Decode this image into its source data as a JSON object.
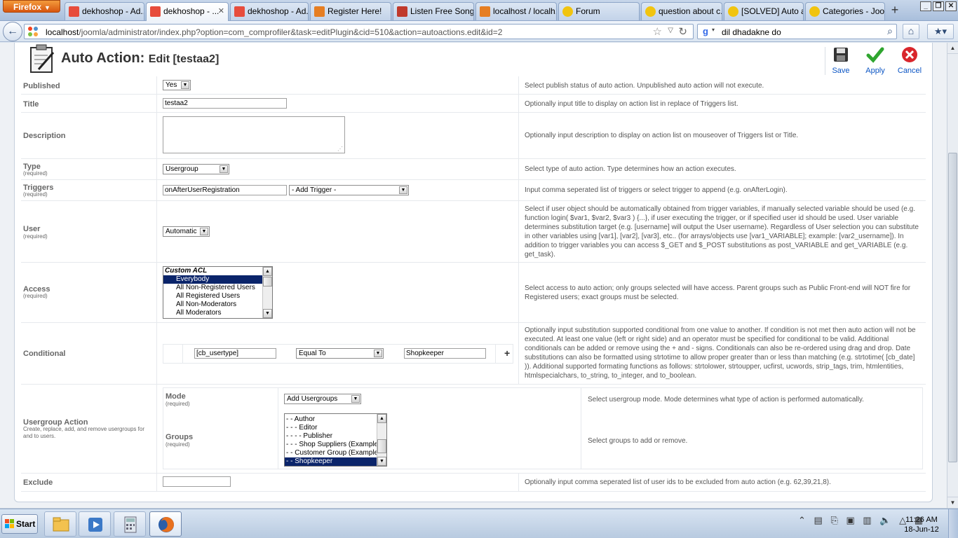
{
  "browser": {
    "menu_label": "Firefox",
    "tabs": [
      {
        "title": "dekhoshop - Ad...",
        "color": "#e74c3c"
      },
      {
        "title": "dekhoshop - ...",
        "color": "#e74c3c"
      },
      {
        "title": "dekhoshop - Ad...",
        "color": "#e74c3c"
      },
      {
        "title": "Register Here!",
        "color": "#e67e22"
      },
      {
        "title": "Listen Free Song...",
        "color": "#c0392b"
      },
      {
        "title": "localhost / localh...",
        "color": "#e67e22"
      },
      {
        "title": "Forum",
        "color": "#f1c40f"
      },
      {
        "title": "question about c...",
        "color": "#f1c40f"
      },
      {
        "title": "[SOLVED] Auto a...",
        "color": "#f1c40f"
      },
      {
        "title": "Categories - Joo...",
        "color": "#f1c40f"
      }
    ],
    "new_tab": "+",
    "url_host": "localhost",
    "url_rest": "/joomla/administrator/index.php?option=com_comprofiler&task=editPlugin&cid=510&action=autoactions.edit&id=2",
    "search_query": "dil dhadakne do"
  },
  "page": {
    "title": "Auto Action:",
    "subtitle": "Edit [testaa2]",
    "toolbar": {
      "save": "Save",
      "apply": "Apply",
      "cancel": "Cancel"
    }
  },
  "form": {
    "required_note": "(required)",
    "published": {
      "label": "Published",
      "value": "Yes",
      "desc": "Select publish status of auto action. Unpublished auto action will not execute."
    },
    "title": {
      "label": "Title",
      "value": "testaa2",
      "desc": "Optionally input title to display on action list in replace of Triggers list."
    },
    "description": {
      "label": "Description",
      "desc": "Optionally input description to display on action list on mouseover of Triggers list or Title."
    },
    "type": {
      "label": "Type",
      "value": "Usergroup",
      "desc": "Select type of auto action. Type determines how an action executes."
    },
    "triggers": {
      "label": "Triggers",
      "value": "onAfterUserRegistration",
      "add": "- Add Trigger -",
      "desc": "Input comma seperated list of triggers or select trigger to append (e.g. onAfterLogin)."
    },
    "user": {
      "label": "User",
      "value": "Automatic",
      "desc": "Select if user object should be automatically obtained from trigger variables, if manually selected variable should be used (e.g. function login( $var1, $var2, $var3 ) {...}, if user executing the trigger, or if specified user id should be used. User variable determines substitution target (e.g. [username] will output the User username). Regardless of User selection you can substitute in other variables using [var1], [var2], [var3], etc.. (for arrays/objects use [var1_VARIABLE]; example: [var2_username]). In addition to trigger variables you can access $_GET and $_POST substitutions as post_VARIABLE and get_VARIABLE (e.g. get_task)."
    },
    "access": {
      "label": "Access",
      "options": [
        "Custom ACL",
        "Everybody",
        "All Non-Registered Users",
        "All Registered Users",
        "All Non-Moderators",
        "All Moderators"
      ],
      "desc": "Select access to auto action; only groups selected will have access. Parent groups such as Public Front-end will NOT fire for Registered users; exact groups must be selected."
    },
    "conditional": {
      "label": "Conditional",
      "left": "[cb_usertype]",
      "operator": "Equal To",
      "right": "Shopkeeper",
      "add": "+",
      "desc": "Optionally input substitution supported conditional from one value to another. If condition is not met then auto action will not be executed. At least one value (left or right side) and an operator must be specified for conditional to be valid. Additional conditionals can be added or remove using the + and - signs. Conditionals can also be re-ordered using drag and drop. Date substitutions can also be formatted using strtotime to allow proper greater than or less than matching (e.g. strtotime( [cb_date] )). Additional supported formating functions as follows: strtolower, strtoupper, ucfirst, ucwords, strip_tags, trim, htmlentities, htmlspecialchars, to_string, to_integer, and to_boolean."
    },
    "usergroup_action": {
      "label": "Usergroup Action",
      "help": "Create, replace, add, and remove usergroups for and to users.",
      "mode": {
        "label": "Mode",
        "value": "Add Usergroups",
        "desc": "Select usergroup mode. Mode determines what type of action is performed automatically."
      },
      "groups": {
        "label": "Groups",
        "options": [
          "- - Author",
          "- - - Editor",
          "- - - - Publisher",
          "- - - Shop Suppliers (Example)",
          "- - Customer Group (Example)",
          "- - Shopkeeper"
        ],
        "desc": "Select groups to add or remove."
      }
    },
    "exclude": {
      "label": "Exclude",
      "desc": "Optionally input comma seperated list of user ids to be excluded from auto action (e.g. 62,39,21,8)."
    }
  },
  "taskbar": {
    "start": "Start",
    "time": "11:26 AM",
    "date": "18-Jun-12"
  }
}
